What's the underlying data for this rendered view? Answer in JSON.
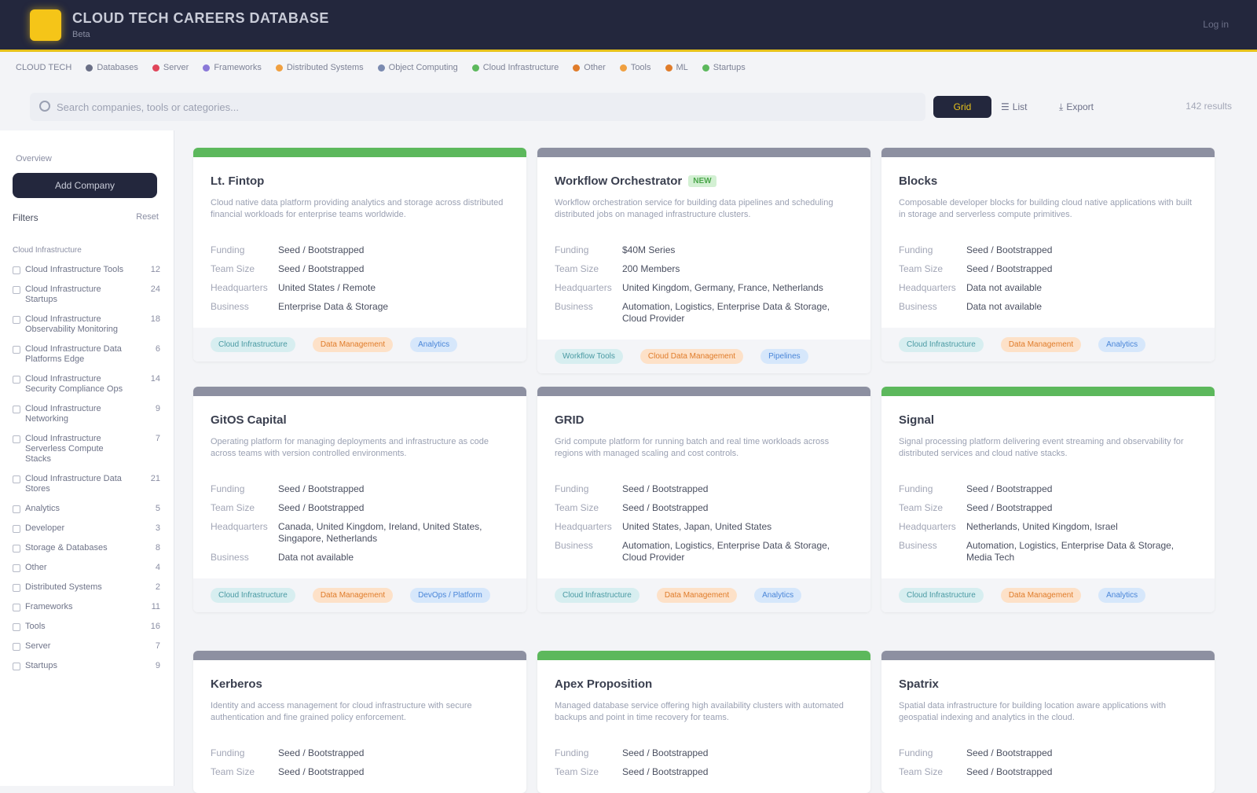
{
  "app": {
    "title": "CLOUD TECH CAREERS DATABASE",
    "subtitle": "Beta",
    "top_right": "Log in"
  },
  "legend": [
    {
      "label": "CLOUD TECH",
      "color": "#c8ccd6"
    },
    {
      "label": "Databases",
      "color": "#6a6f86"
    },
    {
      "label": "Server",
      "color": "#e0455a"
    },
    {
      "label": "Frameworks",
      "color": "#8a78d8"
    },
    {
      "label": "Distributed Systems",
      "color": "#f0a040"
    },
    {
      "label": "Object Computing",
      "color": "#7a8ab0"
    },
    {
      "label": "Cloud Infrastructure",
      "color": "#5cb85c"
    },
    {
      "label": "Other",
      "color": "#e07c2a"
    },
    {
      "label": "Tools",
      "color": "#f0a040"
    },
    {
      "label": "ML",
      "color": "#e07c2a"
    },
    {
      "label": "Startups",
      "color": "#5cb85c"
    }
  ],
  "search": {
    "placeholder": "Search companies, tools or categories...",
    "grid_label": "Grid",
    "list_label": "List",
    "export_label": "Export",
    "count": "142 results"
  },
  "sidebar": {
    "label": "Overview",
    "button": "Add Company",
    "filters_label": "Filters",
    "reset_label": "Reset",
    "items": [
      {
        "label": "Cloud Infrastructure",
        "count": "",
        "group": true
      },
      {
        "label": "Cloud Infrastructure Tools",
        "count": "12"
      },
      {
        "label": "Cloud Infrastructure Startups",
        "count": "24"
      },
      {
        "label": "Cloud Infrastructure Observability Monitoring",
        "count": "18"
      },
      {
        "label": "Cloud Infrastructure Data Platforms Edge",
        "count": "6"
      },
      {
        "label": "Cloud Infrastructure Security Compliance Ops",
        "count": "14"
      },
      {
        "label": "Cloud Infrastructure Networking",
        "count": "9"
      },
      {
        "label": "Cloud Infrastructure Serverless Compute Stacks",
        "count": "7"
      },
      {
        "label": "Cloud Infrastructure Data Stores",
        "count": "21"
      },
      {
        "label": "Analytics",
        "count": "5"
      },
      {
        "label": "Developer",
        "count": "3"
      },
      {
        "label": "Storage & Databases",
        "count": "8"
      },
      {
        "label": "Other",
        "count": "4"
      },
      {
        "label": "Distributed Systems",
        "count": "2"
      },
      {
        "label": "Frameworks",
        "count": "11"
      },
      {
        "label": "Tools",
        "count": "16"
      },
      {
        "label": "Server",
        "count": "7"
      },
      {
        "label": "Startups",
        "count": "9"
      }
    ]
  },
  "cards": [
    {
      "title": "Lt. Fintop",
      "badge": "",
      "desc": "Cloud native data platform providing analytics and storage across distributed financial workloads for enterprise teams worldwide.",
      "bar": "green",
      "rows": [
        [
          "Funding",
          "Seed / Bootstrapped"
        ],
        [
          "Team Size",
          "Seed / Bootstrapped"
        ],
        [
          "Headquarters",
          "United States / Remote"
        ],
        [
          "Business",
          "Enterprise Data & Storage"
        ]
      ],
      "tags": [
        [
          "teal",
          "Cloud Infrastructure"
        ],
        [
          "orange",
          "Data Management"
        ],
        [
          "blue",
          "Analytics"
        ]
      ]
    },
    {
      "title": "Workflow Orchestrator",
      "badge": "NEW",
      "desc": "Workflow orchestration service for building data pipelines and scheduling distributed jobs on managed infrastructure clusters.",
      "bar": "gray",
      "rows": [
        [
          "Funding",
          "$40M Series"
        ],
        [
          "Team Size",
          "200 Members"
        ],
        [
          "Headquarters",
          "United Kingdom, Germany, France, Netherlands"
        ],
        [
          "Business",
          "Automation, Logistics, Enterprise Data & Storage, Cloud Provider"
        ]
      ],
      "tags": [
        [
          "teal",
          "Workflow Tools"
        ],
        [
          "orange",
          "Cloud Data Management"
        ],
        [
          "blue",
          "Pipelines"
        ]
      ]
    },
    {
      "title": "Blocks",
      "badge": "",
      "desc": "Composable developer blocks for building cloud native applications with built in storage and serverless compute primitives.",
      "bar": "gray",
      "rows": [
        [
          "Funding",
          "Seed / Bootstrapped"
        ],
        [
          "Team Size",
          "Seed / Bootstrapped"
        ],
        [
          "Headquarters",
          "Data not available"
        ],
        [
          "Business",
          "Data not available"
        ]
      ],
      "tags": [
        [
          "teal",
          "Cloud Infrastructure"
        ],
        [
          "orange",
          "Data Management"
        ],
        [
          "blue",
          "Analytics"
        ]
      ]
    },
    {
      "title": "GitOS Capital",
      "badge": "",
      "desc": "Operating platform for managing deployments and infrastructure as code across teams with version controlled environments.",
      "bar": "gray",
      "rows": [
        [
          "Funding",
          "Seed / Bootstrapped"
        ],
        [
          "Team Size",
          "Seed / Bootstrapped"
        ],
        [
          "Headquarters",
          "Canada, United Kingdom, Ireland, United States, Singapore, Netherlands"
        ],
        [
          "Business",
          "Data not available"
        ]
      ],
      "tags": [
        [
          "teal",
          "Cloud Infrastructure"
        ],
        [
          "orange",
          "Data Management"
        ],
        [
          "blue",
          "DevOps / Platform"
        ]
      ]
    },
    {
      "title": "GRID",
      "badge": "",
      "desc": "Grid compute platform for running batch and real time workloads across regions with managed scaling and cost controls.",
      "bar": "gray",
      "rows": [
        [
          "Funding",
          "Seed / Bootstrapped"
        ],
        [
          "Team Size",
          "Seed / Bootstrapped"
        ],
        [
          "Headquarters",
          "United States, Japan, United States"
        ],
        [
          "Business",
          "Automation, Logistics, Enterprise Data & Storage, Cloud Provider"
        ]
      ],
      "tags": [
        [
          "teal",
          "Cloud Infrastructure"
        ],
        [
          "orange",
          "Data Management"
        ],
        [
          "blue",
          "Analytics"
        ]
      ]
    },
    {
      "title": "Signal",
      "badge": "",
      "desc": "Signal processing platform delivering event streaming and observability for distributed services and cloud native stacks.",
      "bar": "green",
      "rows": [
        [
          "Funding",
          "Seed / Bootstrapped"
        ],
        [
          "Team Size",
          "Seed / Bootstrapped"
        ],
        [
          "Headquarters",
          "Netherlands, United Kingdom, Israel"
        ],
        [
          "Business",
          "Automation, Logistics, Enterprise Data & Storage, Media Tech"
        ]
      ],
      "tags": [
        [
          "teal",
          "Cloud Infrastructure"
        ],
        [
          "orange",
          "Data Management"
        ],
        [
          "blue",
          "Analytics"
        ]
      ]
    },
    {
      "title": "Kerberos",
      "badge": "",
      "desc": "Identity and access management for cloud infrastructure with secure authentication and fine grained policy enforcement.",
      "bar": "gray",
      "rows": [
        [
          "Funding",
          "Seed / Bootstrapped"
        ],
        [
          "Team Size",
          "Seed / Bootstrapped"
        ]
      ],
      "tags": []
    },
    {
      "title": "Apex Proposition",
      "badge": "",
      "desc": "Managed database service offering high availability clusters with automated backups and point in time recovery for teams.",
      "bar": "green",
      "rows": [
        [
          "Funding",
          "Seed / Bootstrapped"
        ],
        [
          "Team Size",
          "Seed / Bootstrapped"
        ]
      ],
      "tags": []
    },
    {
      "title": "Spatrix",
      "badge": "",
      "desc": "Spatial data infrastructure for building location aware applications with geospatial indexing and analytics in the cloud.",
      "bar": "gray",
      "rows": [
        [
          "Funding",
          "Seed / Bootstrapped"
        ],
        [
          "Team Size",
          "Seed / Bootstrapped"
        ]
      ],
      "tags": []
    }
  ]
}
